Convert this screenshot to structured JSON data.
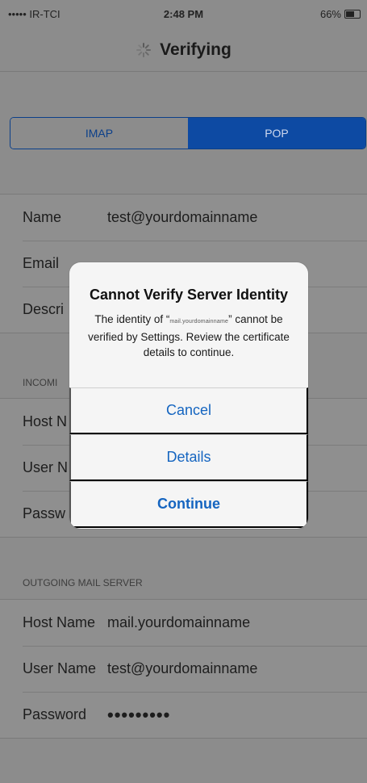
{
  "status_bar": {
    "carrier": "••••• IR-TCI",
    "time": "2:48 PM",
    "battery": "66%"
  },
  "nav": {
    "title": "Verifying"
  },
  "segmented": {
    "imap": "IMAP",
    "pop": "POP",
    "selected": "POP"
  },
  "account": {
    "name_label": "Name",
    "name_value": "test@yourdomainname",
    "email_label": "Email",
    "description_label": "Descri"
  },
  "incoming": {
    "header": "INCOMI",
    "host_label": "Host N",
    "user_label": "User N",
    "password_label": "Passw"
  },
  "outgoing": {
    "header": "OUTGOING MAIL SERVER",
    "host_label": "Host Name",
    "host_value": "mail.yourdomainname",
    "user_label": "User Name",
    "user_value": "test@yourdomainname",
    "password_label": "Password",
    "password_value": "•••••••••"
  },
  "alert": {
    "title": "Cannot Verify Server Identity",
    "message_prefix": "The identity of “",
    "host": "mail.yourdomainname",
    "message_suffix": "” cannot be verified by Settings. Review the certificate details to continue.",
    "cancel": "Cancel",
    "details": "Details",
    "continue": "Continue"
  },
  "colors": {
    "accent": "#0d4aa3",
    "alert_button": "#1565c0"
  }
}
